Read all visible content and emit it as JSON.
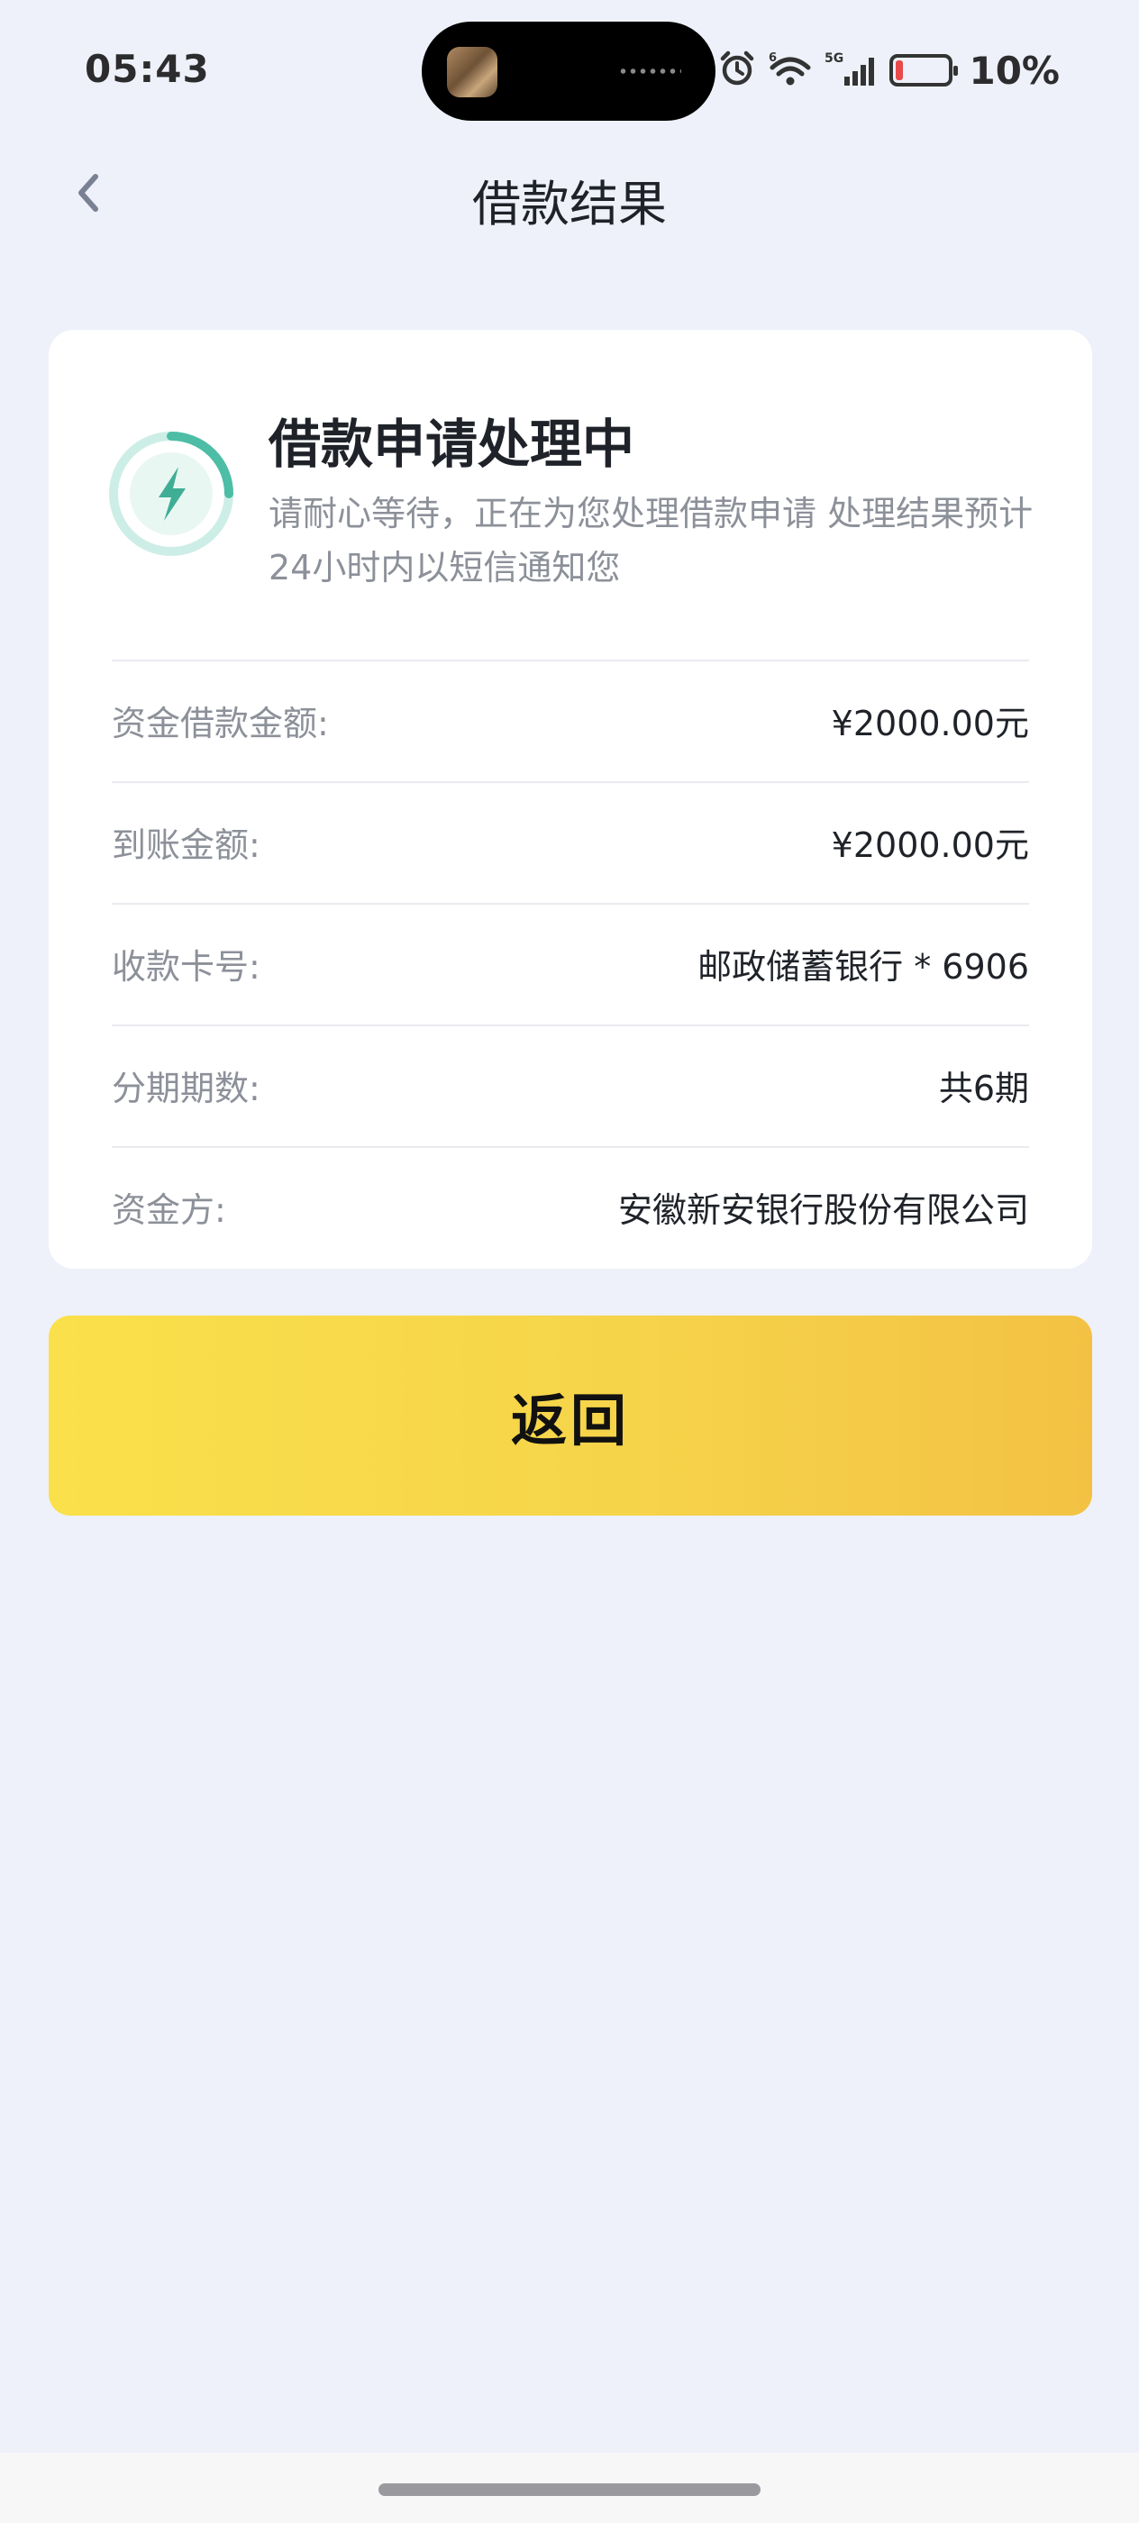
{
  "status_bar": {
    "time": "05:43",
    "battery_percent": "10%",
    "battery_level": 0.1,
    "network": "5G",
    "wifi_badge": "6"
  },
  "nav": {
    "back_icon": "chevron-left-icon",
    "title": "借款结果"
  },
  "result": {
    "icon": "lightning-progress-icon",
    "title": "借款申请处理中",
    "description": "请耐心等待，正在为您处理借款申请 处理结果预计24小时内以短信通知您"
  },
  "details": [
    {
      "label": "资金借款金额:",
      "value": "¥2000.00元"
    },
    {
      "label": "到账金额:",
      "value": "¥2000.00元"
    },
    {
      "label": "收款卡号:",
      "value": "邮政储蓄银行 * 6906"
    },
    {
      "label": "分期期数:",
      "value": "共6期"
    },
    {
      "label": "资金方:",
      "value": "安徽新安银行股份有限公司"
    }
  ],
  "actions": {
    "return_label": "返回"
  },
  "colors": {
    "background": "#eef1f9",
    "accent_teal": "#4dbda6",
    "button_yellow_start": "#fae04a",
    "button_yellow_end": "#f3c244",
    "battery_low": "#e84a4a"
  }
}
